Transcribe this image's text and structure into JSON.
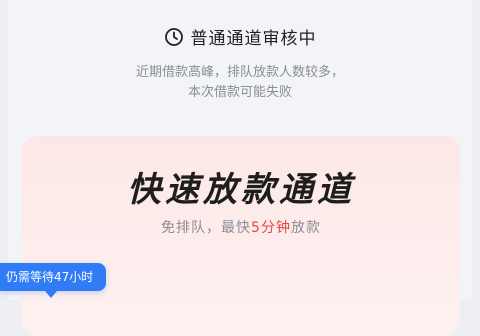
{
  "status": {
    "icon": "clock-icon",
    "title": "普通通道审核中"
  },
  "notice": {
    "line1": "近期借款高峰，排队放款人数较多，",
    "line2": "本次借款可能失败"
  },
  "fast_channel": {
    "title": "快速放款通道",
    "subtitle_prefix": "免排队，最快",
    "subtitle_highlight": "5分钟",
    "subtitle_suffix": "放款"
  },
  "tooltip": {
    "text": "仍需等待47小时"
  },
  "colors": {
    "accent_red": "#e8453c",
    "tooltip_blue": "#2f7cf6",
    "card_pink": "#fde7e6"
  }
}
